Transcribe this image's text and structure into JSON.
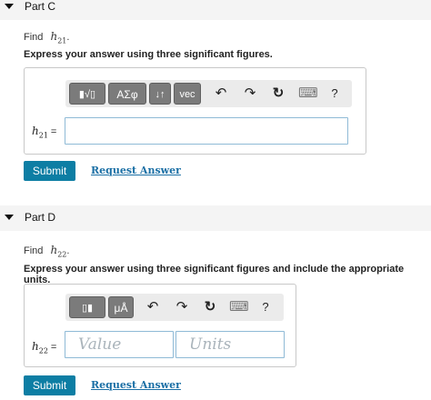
{
  "part_c": {
    "title": "Part C",
    "find_label": "Find",
    "variable": "h",
    "variable_sub": "21",
    "find_period": ".",
    "instruction": "Express your answer using three significant figures.",
    "toolbar": {
      "templates_glyph": "▮√▯",
      "greek_label": "ΑΣφ",
      "arrows_label": "↓↑",
      "vec_label": "vec",
      "undo_glyph": "↶",
      "redo_glyph": "↷",
      "reset_glyph": "↻",
      "keyboard_glyph": "⌨",
      "help_label": "?"
    },
    "answer_value": "",
    "eq_sign": "=",
    "submit_label": "Submit",
    "request_label": "Request Answer"
  },
  "part_d": {
    "title": "Part D",
    "find_label": "Find",
    "variable": "h",
    "variable_sub": "22",
    "find_period": ".",
    "instruction": "Express your answer using three significant figures and include the appropriate units.",
    "toolbar": {
      "templates_glyph": "▯▮",
      "units_label": "μÅ",
      "undo_glyph": "↶",
      "redo_glyph": "↷",
      "reset_glyph": "↻",
      "keyboard_glyph": "⌨",
      "help_label": "?"
    },
    "value_placeholder": "Value",
    "units_placeholder": "Units",
    "eq_sign": "=",
    "submit_label": "Submit",
    "request_label": "Request Answer"
  },
  "colors": {
    "submit_bg": "#0d7ea4",
    "link": "#1a6fa5",
    "input_border": "#8fbad6",
    "toolbar_button": "#7b7b7b"
  }
}
